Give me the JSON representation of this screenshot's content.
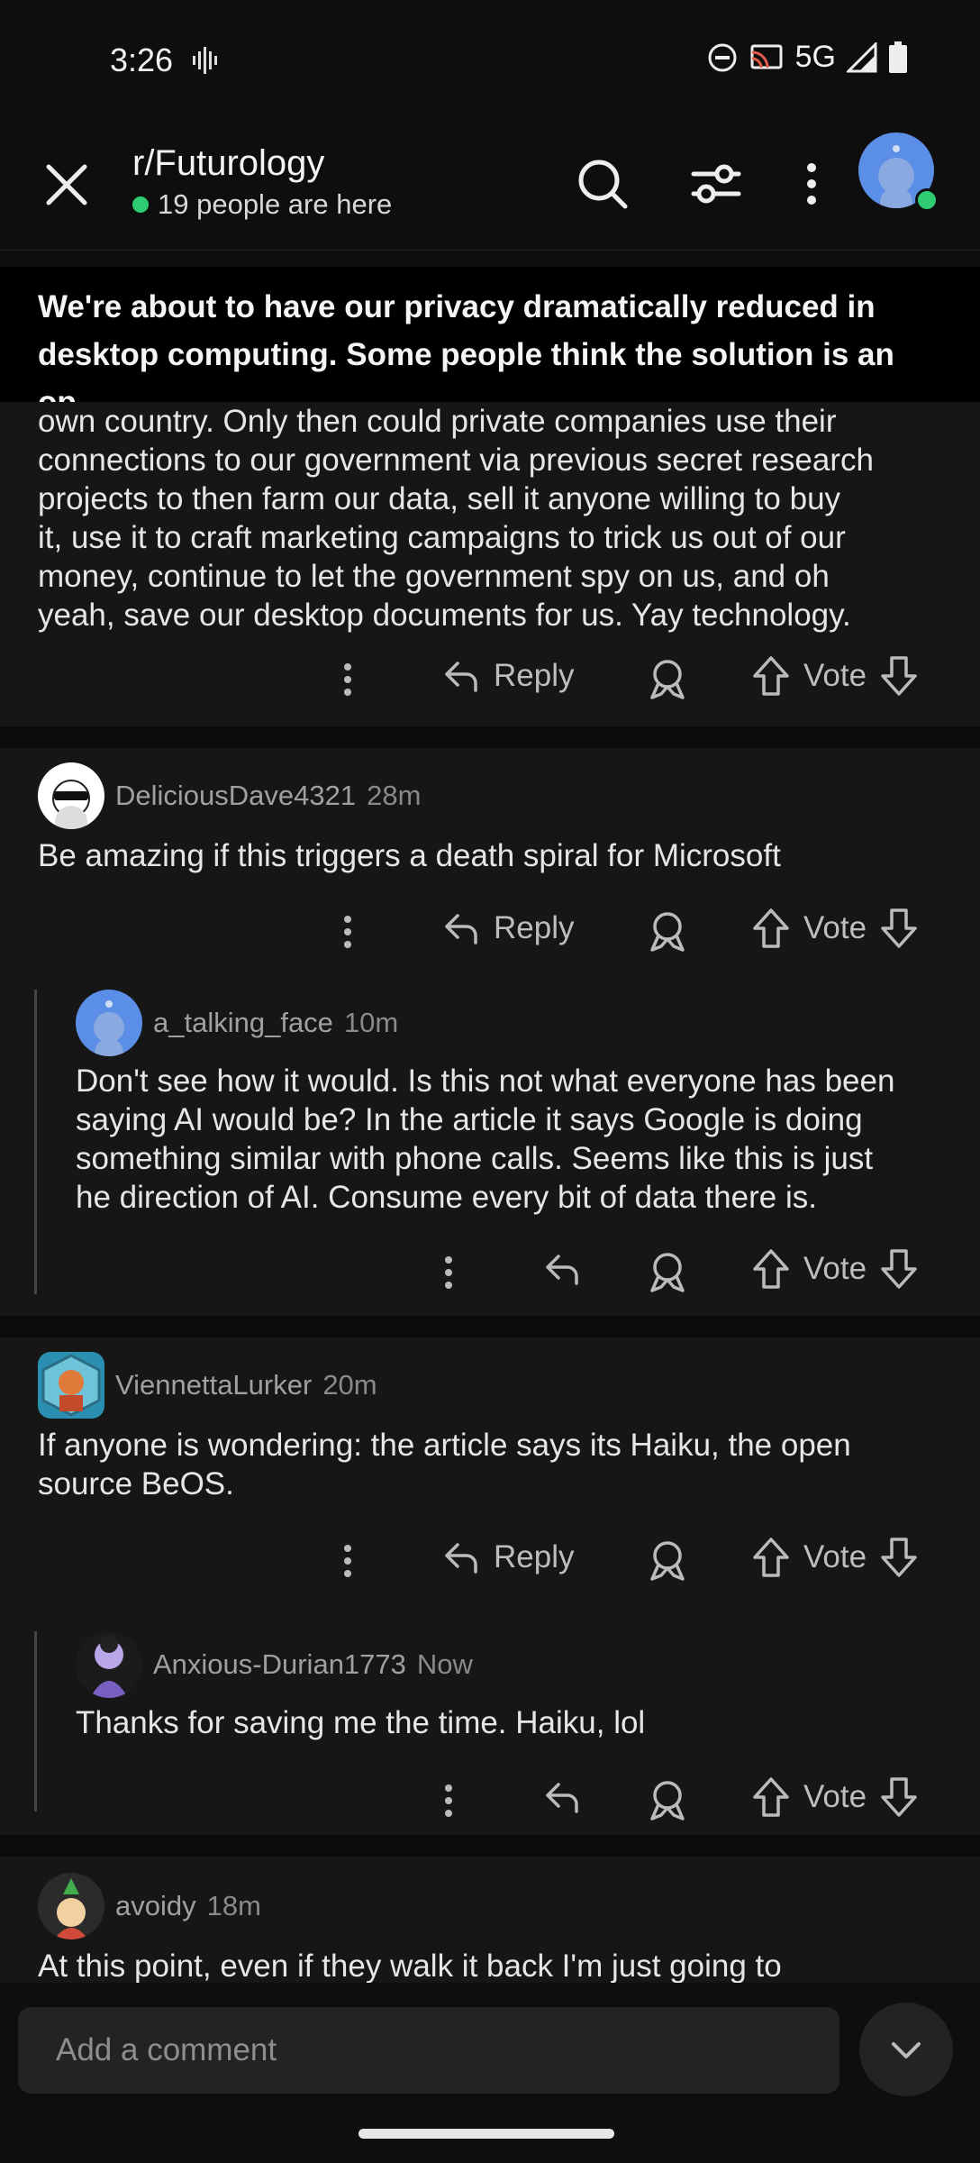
{
  "status": {
    "time": "3:26",
    "network": "5G"
  },
  "header": {
    "subreddit": "r/Futurology",
    "online": "19 people are here"
  },
  "post": {
    "title": "We're about to have our privacy dramatically reduced in desktop computing. Some people think the solution is an op..."
  },
  "colors": {
    "accent_green": "#2ecc71",
    "avatar_blue": "#5b8ee6"
  },
  "comments": [
    {
      "partial": true,
      "lines": [
        "own country. Only then could private companies use their",
        "connections to our government via previous secret research",
        "projects to then farm our data, sell it anyone willing to buy",
        "it, use it to craft marketing campaigns to trick us out of our",
        "money, continue to let the government spy on us, and oh",
        "yeah, save our desktop documents for us. Yay technology."
      ]
    },
    {
      "user": "DeliciousDave4321",
      "time": "28m",
      "lines": [
        "Be amazing if this triggers a death spiral for Microsoft"
      ]
    },
    {
      "user": "a_talking_face",
      "time": "10m",
      "lines": [
        "Don't see how it would. Is this not what everyone has been",
        "saying AI would be? In the article it says Google is doing",
        "something similar with phone calls. Seems like this is just",
        "he direction of AI. Consume every bit of data there is."
      ]
    },
    {
      "user": "ViennettaLurker",
      "time": "20m",
      "lines": [
        "If anyone is wondering: the article says its Haiku, the open",
        "source BeOS."
      ]
    },
    {
      "user": "Anxious-Durian1773",
      "time": "Now",
      "lines": [
        "Thanks for saving me the time. Haiku, lol"
      ]
    },
    {
      "user": "avoidy",
      "time": "18m",
      "lines": [
        "At this point, even if they walk it back I'm just going to"
      ]
    }
  ],
  "actions": {
    "reply": "Reply",
    "vote": "Vote"
  },
  "composer": {
    "placeholder": "Add a comment"
  },
  "icons": [
    "close-icon",
    "search-icon",
    "filter-icon",
    "more-icon",
    "reply-icon",
    "award-icon",
    "upvote-icon",
    "downvote-icon",
    "chevron-down-icon"
  ]
}
